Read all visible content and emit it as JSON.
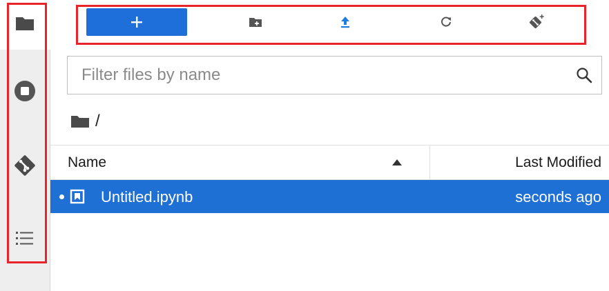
{
  "sidebar": {
    "items": [
      {
        "id": "file-browser",
        "icon": "folder-icon",
        "active": true
      },
      {
        "id": "running",
        "icon": "stop-circle-icon",
        "active": false
      },
      {
        "id": "git",
        "icon": "git-icon",
        "active": false
      },
      {
        "id": "table-of-contents",
        "icon": "list-icon",
        "active": false
      }
    ]
  },
  "toolbar": {
    "buttons": [
      {
        "id": "new-launcher",
        "icon": "plus-icon"
      },
      {
        "id": "new-folder",
        "icon": "new-folder-icon"
      },
      {
        "id": "upload",
        "icon": "upload-icon"
      },
      {
        "id": "refresh",
        "icon": "refresh-icon"
      },
      {
        "id": "git-clone",
        "icon": "git-clone-icon"
      }
    ]
  },
  "filter": {
    "placeholder": "Filter files by name",
    "value": ""
  },
  "breadcrumb": {
    "icon": "folder-icon",
    "path": "/"
  },
  "listing": {
    "columns": {
      "name": "Name",
      "modified": "Last Modified"
    },
    "sort": {
      "column": "name",
      "direction": "ascending"
    },
    "rows": [
      {
        "name": "Untitled.ipynb",
        "modified": "seconds ago",
        "selected": true,
        "running": true,
        "icon": "notebook-icon"
      }
    ]
  },
  "colors": {
    "accent": "#1f70d4",
    "annotation": "#e8232a",
    "sidebar_bg": "#eeeeee",
    "icon_dark": "#555555"
  }
}
